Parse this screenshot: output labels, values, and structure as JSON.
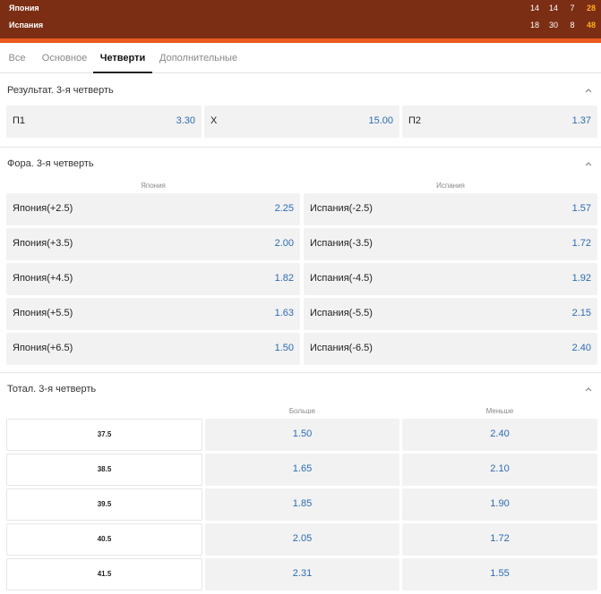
{
  "scoreboard": {
    "teams": [
      {
        "name": "Япония",
        "quarters": [
          "14",
          "14",
          "7"
        ],
        "total": "28"
      },
      {
        "name": "Испания",
        "quarters": [
          "18",
          "30",
          "8"
        ],
        "total": "48"
      }
    ]
  },
  "tabs": [
    {
      "label": "Все",
      "active": false
    },
    {
      "label": "Основное",
      "active": false
    },
    {
      "label": "Четверти",
      "active": true
    },
    {
      "label": "Дополнительные",
      "active": false
    }
  ],
  "result": {
    "title": "Результат. 3-я четверть",
    "outcomes": [
      {
        "label": "П1",
        "odd": "3.30"
      },
      {
        "label": "X",
        "odd": "15.00"
      },
      {
        "label": "П2",
        "odd": "1.37"
      }
    ]
  },
  "handicap": {
    "title": "Фора. 3-я четверть",
    "col_left": "Япония",
    "col_right": "Испания",
    "rows": [
      {
        "left_label": "Япония(+2.5)",
        "left_odd": "2.25",
        "right_label": "Испания(-2.5)",
        "right_odd": "1.57"
      },
      {
        "left_label": "Япония(+3.5)",
        "left_odd": "2.00",
        "right_label": "Испания(-3.5)",
        "right_odd": "1.72"
      },
      {
        "left_label": "Япония(+4.5)",
        "left_odd": "1.82",
        "right_label": "Испания(-4.5)",
        "right_odd": "1.92"
      },
      {
        "left_label": "Япония(+5.5)",
        "left_odd": "1.63",
        "right_label": "Испания(-5.5)",
        "right_odd": "2.15"
      },
      {
        "left_label": "Япония(+6.5)",
        "left_odd": "1.50",
        "right_label": "Испания(-6.5)",
        "right_odd": "2.40"
      }
    ]
  },
  "total": {
    "title": "Тотал. 3-я четверть",
    "col_over": "Больше",
    "col_under": "Меньше",
    "rows": [
      {
        "line": "37.5",
        "over": "1.50",
        "under": "2.40"
      },
      {
        "line": "38.5",
        "over": "1.65",
        "under": "2.10"
      },
      {
        "line": "39.5",
        "over": "1.85",
        "under": "1.90"
      },
      {
        "line": "40.5",
        "over": "2.05",
        "under": "1.72"
      },
      {
        "line": "41.5",
        "over": "2.31",
        "under": "1.55"
      }
    ]
  },
  "colors": {
    "scoreboard_bg": "#7b2e14",
    "accent_stripe": "#ea5b1f",
    "total_score": "#ffae1a",
    "odd_text": "#2c6bb4"
  },
  "icons": {
    "collapse": "chevron-up-icon"
  }
}
